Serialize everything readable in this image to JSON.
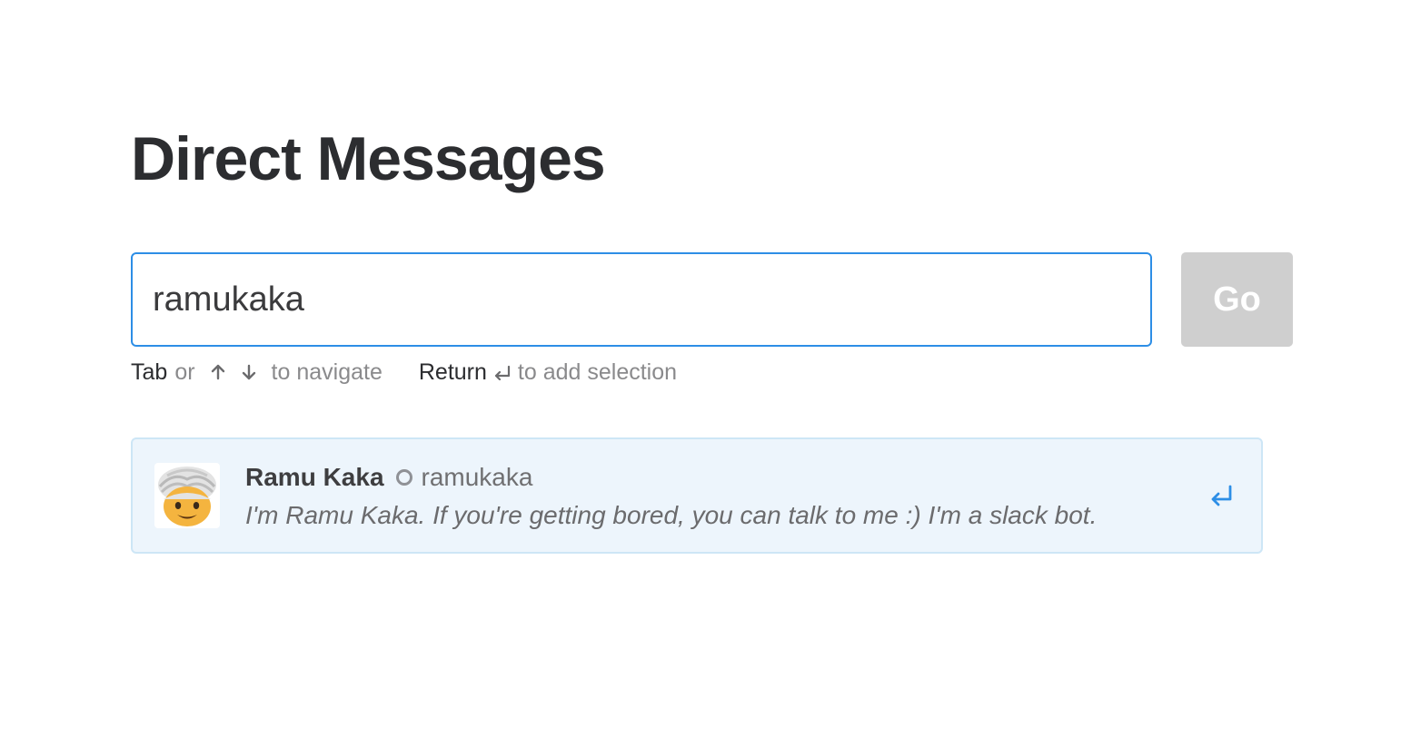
{
  "page": {
    "title": "Direct Messages"
  },
  "search": {
    "value": "ramukaka",
    "go_label": "Go"
  },
  "hint": {
    "tab_key": "Tab",
    "or_text": "or",
    "navigate_text": "to navigate",
    "return_key": "Return",
    "add_text": "to add selection"
  },
  "results": [
    {
      "real_name": "Ramu Kaka",
      "username": "ramukaka",
      "description": "I'm Ramu Kaka. If you're getting bored, you can talk to me :) I'm a slack bot.",
      "presence": "away",
      "avatar_icon": "turbaned-man-avatar-icon"
    }
  ],
  "colors": {
    "focus_border": "#2d8ee6",
    "go_disabled": "#cfcfcf",
    "result_bg": "#edf5fc",
    "result_border": "#cde6f6",
    "enter_icon": "#2d8ee6"
  }
}
